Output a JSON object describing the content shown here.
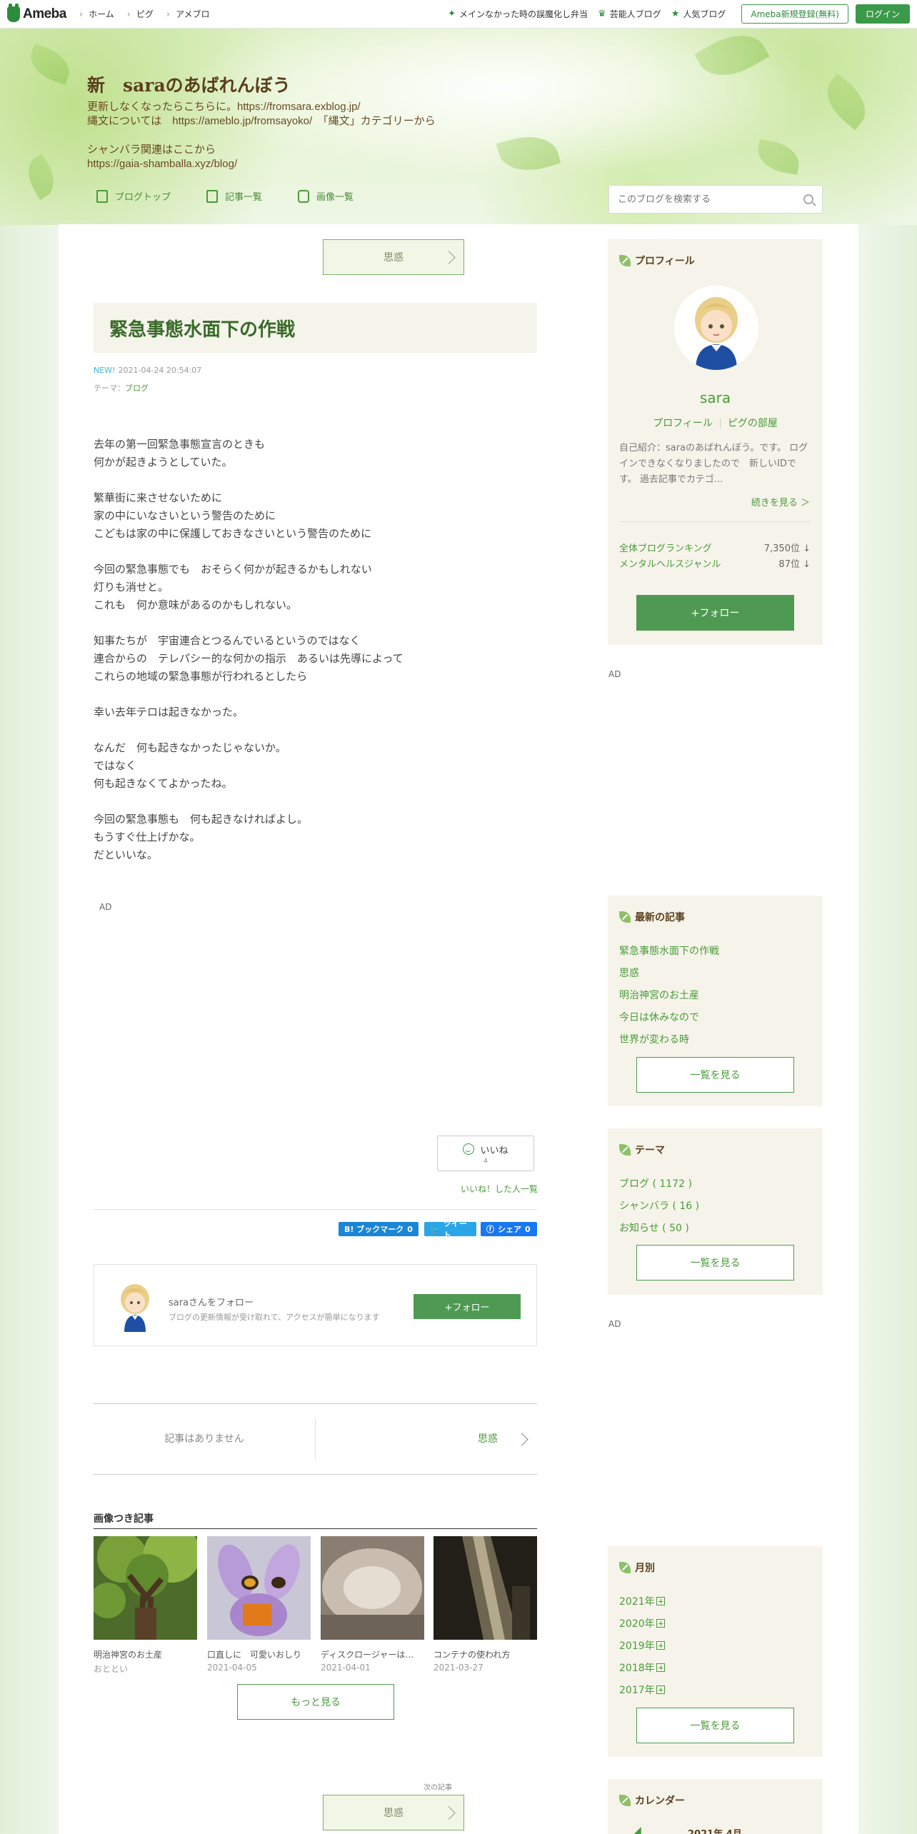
{
  "topbar": {
    "brand": "Ameba",
    "nav": [
      "ホーム",
      "ピグ",
      "アメブロ"
    ],
    "links": [
      {
        "icon": "star-icon",
        "label": "メインなかった時の誤魔化し弁当"
      },
      {
        "icon": "crown-icon",
        "label": "芸能人ブログ"
      },
      {
        "icon": "star-icon",
        "label": "人気ブログ"
      }
    ],
    "register_label": "Ameba新規登録(無料)",
    "login_label": "ログイン"
  },
  "header": {
    "title": "新　saraのあばれんぼう",
    "description": "更新しなくなったらこちらに。https://fromsara.exblog.jp/\n縄文については　https://ameblo.jp/fromsayoko/　「縄文」カテゴリーから\n\nシャンバラ関連はここから\nhttps://gaia-shamballa.xyz/blog/",
    "nav": [
      "ブログトップ",
      "記事一覧",
      "画像一覧"
    ],
    "search_placeholder": "このブログを検索する"
  },
  "pager": {
    "top_label": "思惑",
    "bottom_label": "思惑",
    "next_caption": "次の記事"
  },
  "article": {
    "title": "緊急事態水面下の作戦",
    "new_badge": "NEW!",
    "datetime": "2021-04-24 20:54:07",
    "theme_label": "テーマ：",
    "theme": "ブログ",
    "body": "去年の第一回緊急事態宣言のときも\n何かが起きようとしていた。\n\n繁華街に来させないために\n家の中にいなさいという警告のために\nこどもは家の中に保護しておきなさいという警告のために\n\n今回の緊急事態でも　おそらく何かが起きるかもしれない\n灯りも消せと。\nこれも　何か意味があるのかもしれない。\n\n知事たちが　宇宙連合とつるんでいるというのではなく\n連合からの　テレパシー的な何かの指示　あるいは先導によって\nこれらの地域の緊急事態が行われるとしたら\n\n幸い去年テロは起きなかった。\n\nなんだ　何も起きなかったじゃないか。\nではなく\n何も起きなくてよかったね。\n\n今回の緊急事態も　何も起きなければよし。\nもうすぐ仕上げかな。\nだといいな。"
  },
  "ad_label": "AD",
  "reactions": {
    "iine_label": "いいね",
    "iine_count": "4",
    "iine_list_label": "いいね！した人一覧",
    "hatena_label": "B! ブックマーク",
    "hatena_count": "0",
    "tweet_label": "ツイート",
    "share_label": "シェア",
    "share_count": "0"
  },
  "follow_card": {
    "title": "saraさんをフォロー",
    "subtitle": "ブログの更新情報が受け取れて、アクセスが簡単になります",
    "button": "+フォロー"
  },
  "prevnext": {
    "prev": "記事はありません",
    "next": "思惑"
  },
  "image_articles": {
    "heading": "画像つき記事",
    "items": [
      {
        "caption": "明治神宮のお土産",
        "date": "おととい"
      },
      {
        "caption": "口直しに　可愛いおしり",
        "date": "2021-04-05"
      },
      {
        "caption": "ディスクロージャーは…",
        "date": "2021-04-01"
      },
      {
        "caption": "コンテナの使われ方",
        "date": "2021-03-27"
      }
    ],
    "more_label": "もっと見る"
  },
  "sidebar": {
    "profile": {
      "heading": "プロフィール",
      "name": "sara",
      "link1": "プロフィール",
      "link2": "ピグの部屋",
      "intro": "自己紹介：saraのあばれんぼう。です。 ログインできなくなりましたので　新しいIDです。 過去記事でカテゴ...",
      "continue": "続きを見る ＞",
      "ranking": [
        {
          "label": "全体ブログランキング",
          "value": "7,350位 ↓"
        },
        {
          "label": "メンタルヘルスジャンル",
          "value": "87位 ↓"
        }
      ],
      "follow_button": "+フォロー"
    },
    "recent": {
      "heading": "最新の記事",
      "items": [
        "緊急事態水面下の作戦",
        "思惑",
        "明治神宮のお土産",
        "今日は休みなので",
        "世界が変わる時"
      ],
      "more": "一覧を見る"
    },
    "themes": {
      "heading": "テーマ",
      "items": [
        "ブログ ( 1172 )",
        "シャンバラ ( 16 )",
        "お知らせ ( 50 )"
      ],
      "more": "一覧を見る"
    },
    "monthly": {
      "heading": "月別",
      "items": [
        "2021年",
        "2020年",
        "2019年",
        "2018年",
        "2017年"
      ],
      "more": "一覧を見る"
    },
    "calendar": {
      "heading": "カレンダー",
      "month": "2021年 4月"
    }
  }
}
